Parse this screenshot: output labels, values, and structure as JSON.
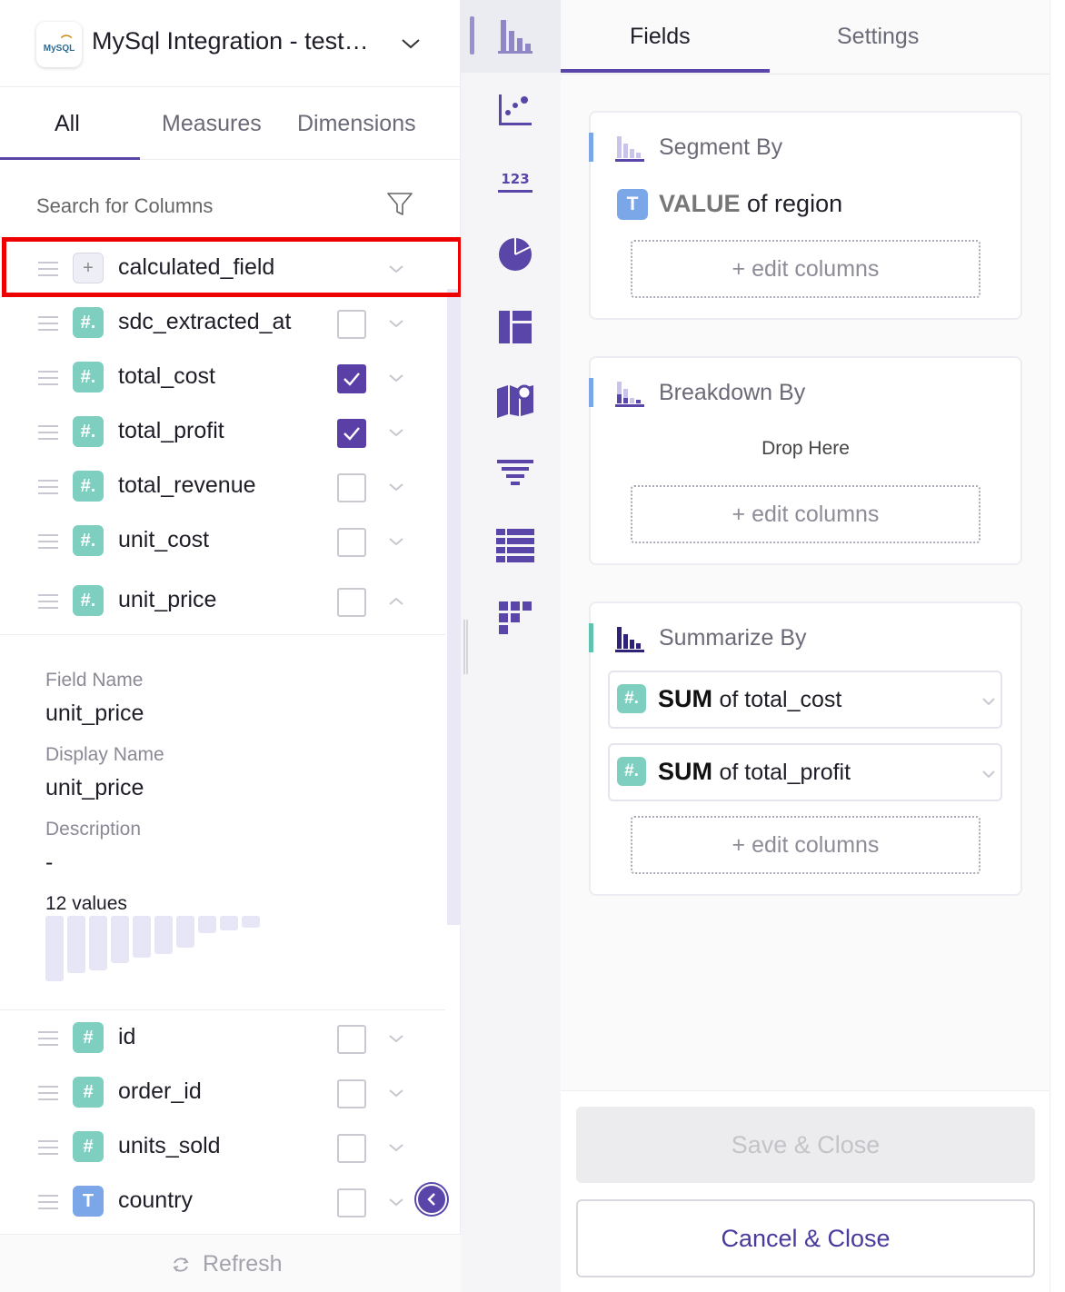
{
  "source": {
    "logo_text": "MySQL",
    "title": "MySql Integration - test…"
  },
  "left_tabs": [
    "All",
    "Measures",
    "Dimensions"
  ],
  "search": {
    "placeholder": "Search for Columns"
  },
  "fields": [
    {
      "name": "calculated_field",
      "type_glyph": "+",
      "type": "calculated",
      "checked": false,
      "highlighted": true
    },
    {
      "name": "sdc_extracted_at",
      "type_glyph": "#.",
      "type": "number",
      "checked": false
    },
    {
      "name": "total_cost",
      "type_glyph": "#.",
      "type": "number",
      "checked": true
    },
    {
      "name": "total_profit",
      "type_glyph": "#.",
      "type": "number",
      "checked": true
    },
    {
      "name": "total_revenue",
      "type_glyph": "#.",
      "type": "number",
      "checked": false
    },
    {
      "name": "unit_cost",
      "type_glyph": "#.",
      "type": "number",
      "checked": false
    },
    {
      "name": "unit_price",
      "type_glyph": "#.",
      "type": "number",
      "checked": false,
      "expanded": true
    }
  ],
  "details": {
    "field_name_label": "Field Name",
    "field_name": "unit_price",
    "display_name_label": "Display Name",
    "display_name": "unit_price",
    "description_label": "Description",
    "description": "-",
    "values_count": "12 values",
    "histogram": [
      1.0,
      0.88,
      0.84,
      0.72,
      0.64,
      0.58,
      0.48,
      0.26,
      0.22,
      0.18
    ]
  },
  "fields_more": [
    {
      "name": "id",
      "type_glyph": "#",
      "type": "integer",
      "checked": false
    },
    {
      "name": "order_id",
      "type_glyph": "#",
      "type": "integer",
      "checked": false
    },
    {
      "name": "units_sold",
      "type_glyph": "#",
      "type": "integer",
      "checked": false
    },
    {
      "name": "country",
      "type_glyph": "T",
      "type": "text",
      "checked": false
    }
  ],
  "refresh_label": "Refresh",
  "rail_icons": [
    "bar-chart-icon",
    "scatter-chart-icon",
    "number-icon",
    "pie-chart-icon",
    "layout-icon",
    "map-icon",
    "funnel-icon",
    "table-icon",
    "pivot-icon"
  ],
  "rail_number_text": "123",
  "right_tabs": [
    "Fields",
    "Settings"
  ],
  "segment_by": {
    "title": "Segment By",
    "value_badge": "T",
    "value_agg": "VALUE",
    "value_field": "of region",
    "edit_label": "+ edit columns"
  },
  "breakdown_by": {
    "title": "Breakdown By",
    "placeholder": "Drop Here",
    "edit_label": "+ edit columns"
  },
  "summarize_by": {
    "title": "Summarize By",
    "items": [
      {
        "badge": "#.",
        "agg": "SUM",
        "field": "of total_cost"
      },
      {
        "badge": "#.",
        "agg": "SUM",
        "field": "of total_profit"
      }
    ],
    "edit_label": "+ edit columns"
  },
  "buttons": {
    "save": "Save & Close",
    "cancel": "Cancel & Close"
  },
  "colors": {
    "accent": "#5a46a8",
    "number_badge": "#7ecfbf",
    "text_badge": "#7ba6e8",
    "segment_accent": "#7ba6e8",
    "summarize_accent": "#5fc3ad",
    "highlight": "#ee0000"
  }
}
